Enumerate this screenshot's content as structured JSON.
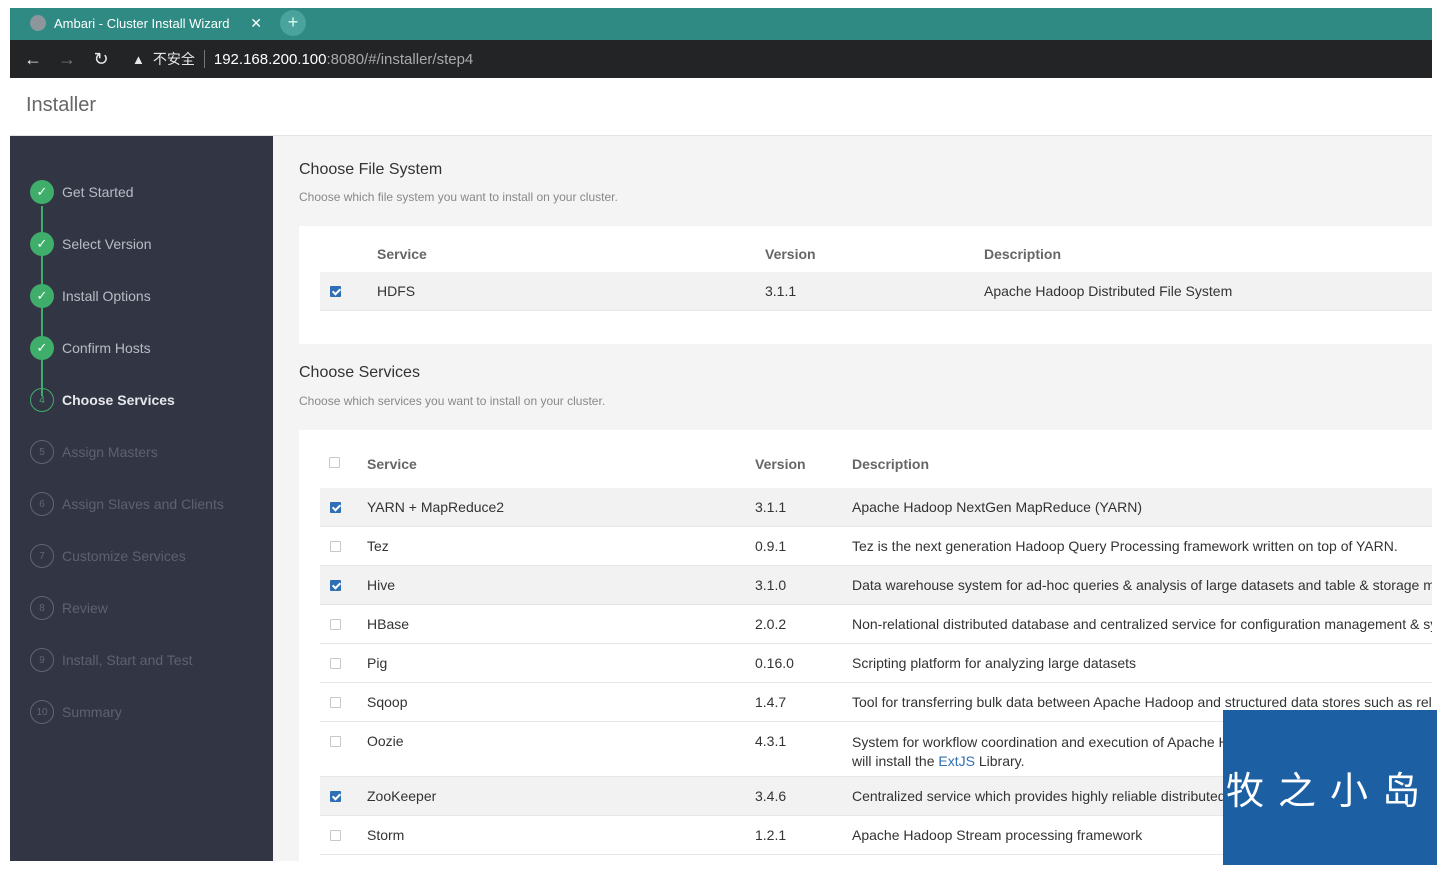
{
  "browser": {
    "tab_title": "Ambari - Cluster Install Wizard",
    "tab_close": "✕",
    "new_tab": "+",
    "back": "←",
    "forward": "→",
    "reload": "↻",
    "warning_icon": "▲",
    "insecure_label": "不安全",
    "url_host": "192.168.200.100",
    "url_rest": ":8080/#/installer/step4"
  },
  "header": {
    "title": "Installer"
  },
  "sidebar": {
    "steps": [
      {
        "num": "✓",
        "label": "Get Started",
        "state": "done"
      },
      {
        "num": "✓",
        "label": "Select Version",
        "state": "done"
      },
      {
        "num": "✓",
        "label": "Install Options",
        "state": "done"
      },
      {
        "num": "✓",
        "label": "Confirm Hosts",
        "state": "done"
      },
      {
        "num": "4",
        "label": "Choose Services",
        "state": "current"
      },
      {
        "num": "5",
        "label": "Assign Masters",
        "state": "todo"
      },
      {
        "num": "6",
        "label": "Assign Slaves and Clients",
        "state": "todo"
      },
      {
        "num": "7",
        "label": "Customize Services",
        "state": "todo"
      },
      {
        "num": "8",
        "label": "Review",
        "state": "todo"
      },
      {
        "num": "9",
        "label": "Install, Start and Test",
        "state": "todo"
      },
      {
        "num": "10",
        "label": "Summary",
        "state": "todo"
      }
    ]
  },
  "filesystem": {
    "title": "Choose File System",
    "subtitle": "Choose which file system you want to install on your cluster.",
    "headers": {
      "service": "Service",
      "version": "Version",
      "description": "Description"
    },
    "rows": [
      {
        "checked": true,
        "service": "HDFS",
        "version": "3.1.1",
        "description": "Apache Hadoop Distributed File System"
      }
    ]
  },
  "services": {
    "title": "Choose Services",
    "subtitle": "Choose which services you want to install on your cluster.",
    "headers": {
      "service": "Service",
      "version": "Version",
      "description": "Description"
    },
    "rows": [
      {
        "checked": true,
        "service": "YARN + MapReduce2",
        "version": "3.1.1",
        "description": "Apache Hadoop NextGen MapReduce (YARN)"
      },
      {
        "checked": false,
        "service": "Tez",
        "version": "0.9.1",
        "description": "Tez is the next generation Hadoop Query Processing framework written on top of YARN."
      },
      {
        "checked": true,
        "service": "Hive",
        "version": "3.1.0",
        "description": "Data warehouse system for ad-hoc queries & analysis of large datasets and table & storage ma"
      },
      {
        "checked": false,
        "service": "HBase",
        "version": "2.0.2",
        "description": "Non-relational distributed database and centralized service for configuration management & sy"
      },
      {
        "checked": false,
        "service": "Pig",
        "version": "0.16.0",
        "description": "Scripting platform for analyzing large datasets"
      },
      {
        "checked": false,
        "service": "Sqoop",
        "version": "1.4.7",
        "description": "Tool for transferring bulk data between Apache Hadoop and structured data stores such as rela"
      },
      {
        "checked": false,
        "service": "Oozie",
        "version": "4.3.1",
        "description": "System for workflow coordination and execution of Apache H",
        "description_line2_pre": "will install the ",
        "description_link": "ExtJS",
        "description_line2_post": " Library."
      },
      {
        "checked": true,
        "service": "ZooKeeper",
        "version": "3.4.6",
        "description": "Centralized service which provides highly reliable distributed"
      },
      {
        "checked": false,
        "service": "Storm",
        "version": "1.2.1",
        "description": "Apache Hadoop Stream processing framework"
      }
    ]
  },
  "watermark": {
    "text": "牧之小岛"
  },
  "colors": {
    "sidebar_bg": "#323544",
    "done_green": "#3fae6a",
    "checkbox_blue": "#2f6fb3",
    "tabbar": "#2e8a83"
  }
}
